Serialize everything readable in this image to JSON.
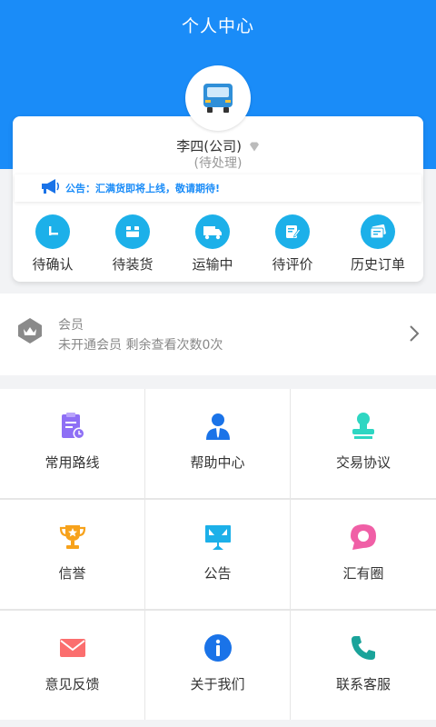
{
  "header": {
    "title": "个人中心"
  },
  "user": {
    "name": "李四(公司)",
    "status": "(待处理)"
  },
  "notice": {
    "text": "公告：汇满货即将上线，敬请期待!"
  },
  "orders": [
    {
      "label": "待确认",
      "icon": "plus-minus-icon"
    },
    {
      "label": "待装货",
      "icon": "box-icon"
    },
    {
      "label": "运输中",
      "icon": "truck-icon"
    },
    {
      "label": "待评价",
      "icon": "edit-icon"
    },
    {
      "label": "历史订单",
      "icon": "history-icon"
    }
  ],
  "member": {
    "title": "会员",
    "desc": "未开通会员 剩余查看次数0次"
  },
  "grid": [
    {
      "label": "常用路线",
      "icon": "clipboard-clock-icon",
      "color": "#8e6ff5"
    },
    {
      "label": "帮助中心",
      "icon": "support-person-icon",
      "color": "#1a73e8"
    },
    {
      "label": "交易协议",
      "icon": "stamp-icon",
      "color": "#2ed6c2"
    },
    {
      "label": "信誉",
      "icon": "trophy-icon",
      "color": "#f7a21b"
    },
    {
      "label": "公告",
      "icon": "billboard-icon",
      "color": "#1cb0e9"
    },
    {
      "label": "汇有圈",
      "icon": "chat-bubble-icon",
      "color": "#f05fa6"
    },
    {
      "label": "意见反馈",
      "icon": "mail-icon",
      "color": "#fb6e6e"
    },
    {
      "label": "关于我们",
      "icon": "info-icon",
      "color": "#1a73e8"
    },
    {
      "label": "联系客服",
      "icon": "phone-icon",
      "color": "#1aa39a"
    }
  ]
}
